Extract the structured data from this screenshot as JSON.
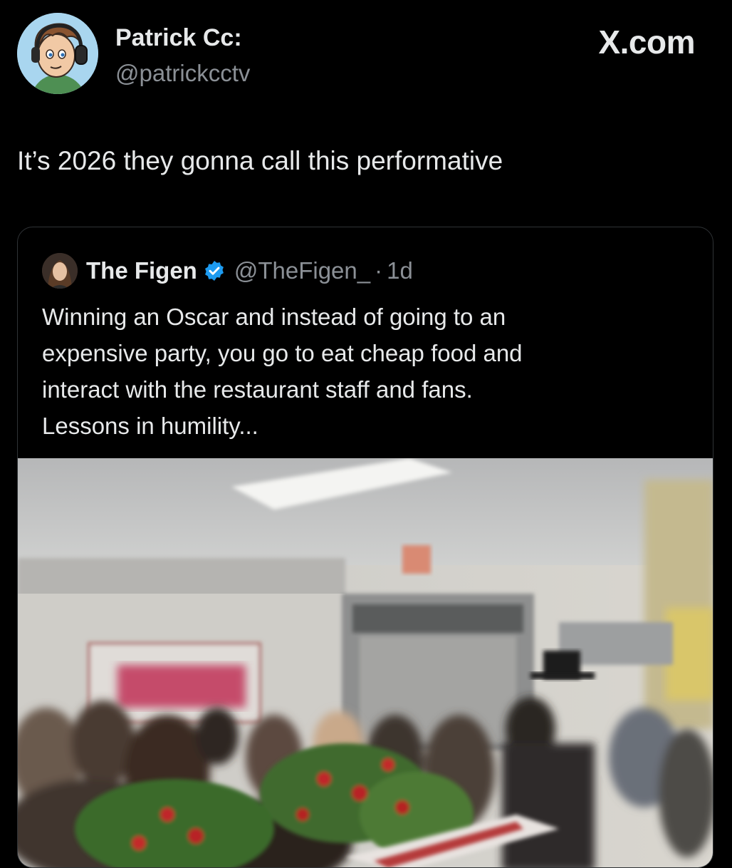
{
  "author": {
    "name": "Patrick Cc:",
    "handle": "@patrickcctv",
    "avatar_icon": "cartoon-avatar-icon"
  },
  "site_label": "X.com",
  "post": {
    "text": "It’s 2026 they gonna call this performative"
  },
  "quoted_post": {
    "name": "The Figen",
    "verified_icon": "verified-badge-icon",
    "verified_color": "#1d9bf0",
    "handle": "@TheFigen_",
    "separator": "·",
    "time": "1d",
    "text_lines": [
      "Winning an Oscar and instead of going to an",
      "expensive party, you go to eat cheap food and",
      "interact with the restaurant staff and fans.",
      "Lessons in humility..."
    ],
    "media": {
      "type": "video-still",
      "subject": "crowd-in-restaurant-with-flowers"
    }
  },
  "colors": {
    "background": "#000000",
    "text_primary": "#e7e9ea",
    "text_secondary": "#8b9096",
    "border": "#2f3336"
  }
}
